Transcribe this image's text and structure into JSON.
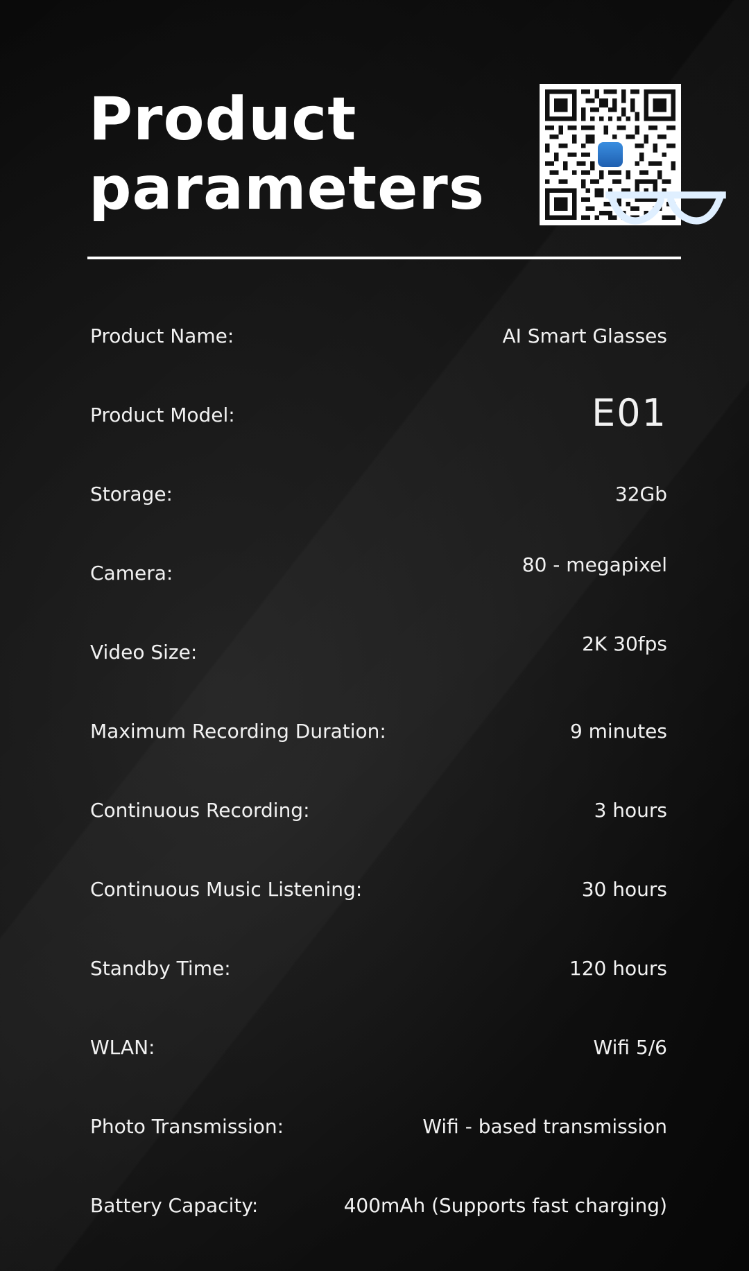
{
  "header": {
    "title_line1": "Product",
    "title_line2": "parameters"
  },
  "qr_code": {
    "icon": "qr-code-icon",
    "logo_icon": "glasses-app-icon",
    "logo_color": "#2f7fd6"
  },
  "colors": {
    "background": "#0b0b0b",
    "text": "#ffffff"
  },
  "specs": [
    {
      "label": "Product Name:",
      "value": "AI Smart Glasses"
    },
    {
      "label": "Product Model:",
      "value": "E01"
    },
    {
      "label": "Storage:",
      "value": "32Gb"
    },
    {
      "label": "Camera:",
      "value": "80 - megapixel"
    },
    {
      "label": "Video Size:",
      "value": "2K 30fps"
    },
    {
      "label": "Maximum Recording Duration:",
      "value": "9 minutes"
    },
    {
      "label": "Continuous Recording:",
      "value": "3 hours"
    },
    {
      "label": "Continuous Music Listening:",
      "value": "30 hours"
    },
    {
      "label": "Standby Time:",
      "value": "120 hours"
    },
    {
      "label": "WLAN:",
      "value": "Wifi 5/6"
    },
    {
      "label": "Photo Transmission:",
      "value": "Wifi - based transmission"
    },
    {
      "label": "Battery Capacity:",
      "value": "400mAh (Supports fast charging)"
    }
  ]
}
